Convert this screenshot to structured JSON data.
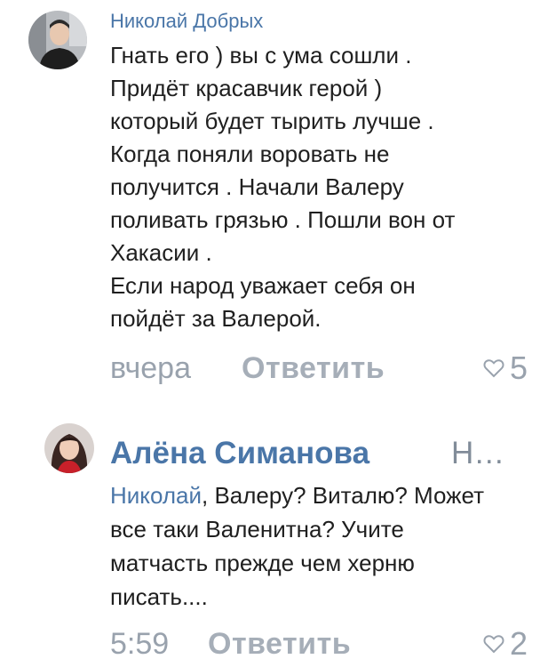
{
  "comments": [
    {
      "author": "Николай Добрых",
      "lines": [
        "Гнать его ) вы с ума сошли .",
        "Придёт красавчик герой )",
        "который будет тырить лучше .",
        "Когда поняли воровать не",
        "получится . Начали Валеру",
        "поливать грязью . Пошли вон от",
        "Хакасии .",
        "Если народ уважает себя он",
        "пойдёт за Валерой."
      ],
      "date": "вчера",
      "reply_label": "Ответить",
      "likes": "5",
      "avatar_icon": "user-photo-avatar"
    },
    {
      "author": "Алёна Симанова",
      "author_extra": "Н…",
      "mention": "Николай",
      "line1_rest": ", Валеру? Виталю? Может",
      "lines": [
        "все таки Валенитна? Учите",
        "матчасть прежде чем херню",
        "писать...."
      ],
      "date": "5:59",
      "reply_label": "Ответить",
      "likes": "2",
      "avatar_icon": "user-photo-avatar"
    }
  ],
  "colors": {
    "link": "#4a76a8",
    "text": "#1f1f1f",
    "secondary": "#99a2ad"
  },
  "icons": {
    "like": "heart-outline-icon"
  }
}
